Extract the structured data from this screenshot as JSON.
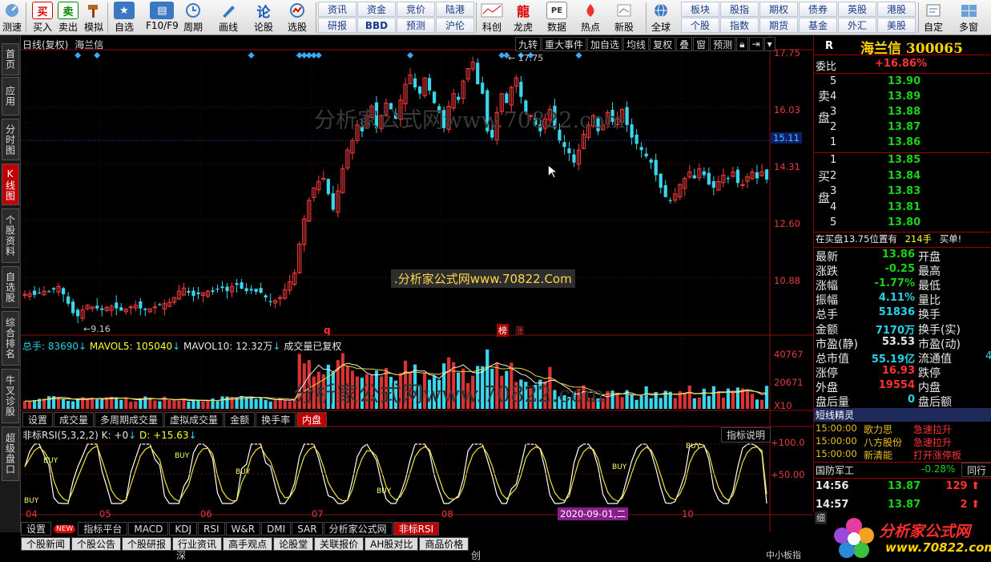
{
  "toolbar": {
    "items": [
      {
        "label": "测速",
        "icon": "speed-icon"
      },
      {
        "label": "买入",
        "icon": "buy-icon",
        "glyph": "买"
      },
      {
        "label": "卖出",
        "icon": "sell-icon",
        "glyph": "卖"
      },
      {
        "label": "模拟",
        "icon": "hammer-icon"
      },
      {
        "label": "自选",
        "icon": "star-icon"
      },
      {
        "label": "F10/F9",
        "icon": "f10-icon"
      },
      {
        "label": "周期",
        "icon": "clock-icon"
      },
      {
        "label": "画线",
        "icon": "pen-icon"
      },
      {
        "label": "论股",
        "icon": "chat-icon",
        "glyph": "论"
      },
      {
        "label": "选股",
        "icon": "select-icon"
      }
    ],
    "grid": [
      [
        "资讯",
        "资金",
        "竞价",
        "陆港"
      ],
      [
        "研报",
        "BBD",
        "预测",
        "沪伦"
      ]
    ],
    "items2": [
      {
        "label": "科创",
        "icon": "chart-icon"
      },
      {
        "label": "龙虎",
        "icon": "dragon-icon"
      },
      {
        "label": "数据",
        "icon": "pe-icon"
      },
      {
        "label": "热点",
        "icon": "hot-icon"
      },
      {
        "label": "新股",
        "icon": "newstock-icon"
      },
      {
        "label": "全球",
        "icon": "globe-icon"
      }
    ],
    "grid2": [
      [
        "板块",
        "股指",
        "期权",
        "债券",
        "英股",
        "港股"
      ],
      [
        "个股",
        "指数",
        "期货",
        "基金",
        "外汇",
        "美股"
      ]
    ],
    "items3": [
      {
        "label": "自定",
        "icon": "custom-icon"
      },
      {
        "label": "多窗",
        "icon": "multiwin-icon"
      }
    ]
  },
  "left_tabs": [
    "首页",
    "应用",
    "分时图",
    "K线图",
    "个股资料",
    "自选股",
    "综合排名",
    "牛叉诊股",
    "超级盘口"
  ],
  "chart": {
    "title": "日线(复权)",
    "stock": "海兰信",
    "top_buttons": [
      "九转",
      "重大事件",
      "加自选",
      "均线",
      "复权",
      "叠",
      "窗",
      "预测"
    ],
    "price_axis": [
      "17.75",
      "16.03",
      "15.11",
      "14.31",
      "12.60",
      "10.88"
    ],
    "high_label": "17.75",
    "low_label": "9.16",
    "marker_q": "q",
    "marker_list": "榜",
    "marker_zhang": "涨",
    "watermark": "分析家公式网www.70822.com",
    "watermark_center": ".分析家公式网www.70822.Com",
    "volume_header": {
      "a": "总手: 83690",
      "b": "MAVOL5: 105040",
      "c": "MAVOL10: 12.32万",
      "d": "成交量已复权"
    },
    "volume_axis": [
      "40767",
      "20671",
      "X10"
    ],
    "vol_tabs": [
      "设置",
      "成交量",
      "多周期成交量",
      "虚拟成交量",
      "金额",
      "换手率",
      "内盘"
    ],
    "rsi_header": {
      "a": "非标RSI(5,3,2,2)",
      "b": "K: +0",
      "c": "D: +15.63"
    },
    "rsi_help": "指标说明",
    "rsi_axis": [
      "+100.0",
      "+50.00"
    ],
    "buy_label": "BUY",
    "months": [
      "04",
      "05",
      "06",
      "07",
      "08",
      "10"
    ],
    "cursor_date": "2020-09-01,二",
    "bottom_tabs": [
      "设置",
      "NEW",
      "指标平台",
      "MACD",
      "KDJ",
      "RSI",
      "W&R",
      "DMI",
      "SAR",
      "分析家公式网",
      "非标RSI"
    ],
    "news_tabs": [
      "个股新闻",
      "个股公告",
      "个股研报",
      "行业资讯",
      "高手观点",
      "论股堂",
      "关联报价",
      "AH股对比",
      "商品价格"
    ],
    "sh": "深",
    "cy": "创",
    "small": "中小板指"
  },
  "quote": {
    "r": "R",
    "name": "海兰信",
    "code": "300065",
    "wei_label": "委比",
    "wei_value": "+16.86%",
    "sell_label": "卖盘",
    "buy_label": "买盘",
    "asks": [
      {
        "lv": "5",
        "p": "13.90"
      },
      {
        "lv": "4",
        "p": "13.89"
      },
      {
        "lv": "3",
        "p": "13.88"
      },
      {
        "lv": "2",
        "p": "13.87"
      },
      {
        "lv": "1",
        "p": "13.86"
      }
    ],
    "bids": [
      {
        "lv": "1",
        "p": "13.85"
      },
      {
        "lv": "2",
        "p": "13.84"
      },
      {
        "lv": "3",
        "p": "13.83"
      },
      {
        "lv": "4",
        "p": "13.81"
      },
      {
        "lv": "5",
        "p": "13.80"
      }
    ],
    "notice": {
      "a": "在买盘13.75位置有",
      "b": "214手",
      "c": "买单!"
    },
    "stats": [
      {
        "k": "最新",
        "v": "13.86",
        "c": "grn",
        "k2": "开盘"
      },
      {
        "k": "涨跌",
        "v": "-0.25",
        "c": "grn",
        "k2": "最高"
      },
      {
        "k": "涨幅",
        "v": "-1.77%",
        "c": "grn",
        "k2": "最低"
      },
      {
        "k": "振幅",
        "v": "4.11%",
        "c": "cyan",
        "k2": "量比"
      },
      {
        "k": "总手",
        "v": "51836",
        "c": "cyan",
        "k2": "换手"
      },
      {
        "k": "金额",
        "v": "7170万",
        "c": "cyan",
        "k2": "换手(实)"
      },
      {
        "k": "市盈(静)",
        "v": "53.53",
        "c": "wht",
        "k2": "市盈(动)"
      },
      {
        "k": "总市值",
        "v": "55.19亿",
        "c": "cyan",
        "k2": "流通值",
        "v2": "4"
      },
      {
        "k": "涨停",
        "v": "16.93",
        "c": "red",
        "k2": "跌停"
      },
      {
        "k": "外盘",
        "v": "19554",
        "c": "red",
        "k2": "内盘"
      },
      {
        "k": "盘后量",
        "v": "0",
        "c": "cyan",
        "k2": "盘后额"
      }
    ],
    "sprite_title": "短线精灵",
    "sprite": [
      {
        "t": "15:00:00",
        "n": "歌力思",
        "e": "急速拉升"
      },
      {
        "t": "15:00:00",
        "n": "八方股份",
        "e": "急速拉升"
      },
      {
        "t": "15:00:00",
        "n": "新清能",
        "e": "打开涨停板"
      }
    ],
    "sector": {
      "name": "国防军工",
      "chg": "-0.28%",
      "btn": "同行"
    },
    "ticks": [
      {
        "t": "14:56",
        "p": "13.87",
        "v": "129"
      },
      {
        "t": "14:57",
        "p": "13.87",
        "v": "2"
      }
    ],
    "detail_tab": "细",
    "logo": "分析家公式网",
    "logo_url": "www.70822.com"
  },
  "chart_data": {
    "type": "candlestick",
    "title": "日线(复权) 海兰信",
    "x_months": [
      "04",
      "05",
      "06",
      "07",
      "08",
      "10"
    ],
    "ylim": [
      9.0,
      17.9
    ],
    "high": 17.75,
    "low": 9.16,
    "close_series": [
      10.2,
      10.22,
      10.18,
      10.25,
      10.3,
      10.28,
      10.35,
      10.45,
      10.2,
      9.9,
      9.6,
      9.5,
      9.7,
      9.85,
      9.8,
      9.75,
      9.7,
      9.78,
      9.82,
      9.75,
      9.68,
      9.72,
      9.8,
      9.85,
      9.75,
      9.7,
      9.74,
      9.8,
      9.85,
      9.9,
      9.95,
      10.1,
      10.3,
      10.4,
      10.25,
      10.15,
      10.2,
      10.25,
      10.3,
      10.28,
      10.35,
      10.4,
      10.3,
      10.45,
      10.5,
      10.38,
      10.3,
      10.32,
      10.28,
      10.25,
      10.1,
      9.95,
      10.0,
      10.1,
      10.35,
      10.6,
      10.88,
      11.8,
      12.6,
      13.2,
      13.6,
      13.8,
      13.9,
      13.4,
      12.9,
      13.5,
      14.2,
      14.8,
      15.1,
      15.6,
      15.4,
      15.9,
      16.2,
      15.5,
      15.9,
      16.3,
      16.1,
      15.8,
      16.4,
      16.9,
      17.2,
      16.8,
      16.6,
      17.1,
      16.7,
      16.3,
      16.0,
      15.5,
      16.2,
      16.6,
      16.4,
      17.0,
      17.4,
      17.6,
      16.9,
      16.6,
      15.4,
      15.2,
      16.0,
      16.6,
      16.3,
      16.8,
      17.1,
      16.5,
      16.0,
      15.9,
      15.6,
      15.4,
      15.8,
      16.1,
      15.5,
      15.1,
      14.9,
      14.7,
      14.4,
      14.8,
      15.3,
      15.6,
      15.9,
      15.4,
      15.6,
      16.0,
      15.7,
      15.8,
      16.1,
      15.6,
      15.2,
      15.0,
      14.8,
      14.6,
      14.4,
      14.0,
      13.6,
      13.3,
      13.2,
      13.4,
      13.7,
      13.9,
      14.1,
      13.9,
      14.2,
      14.0,
      13.7,
      13.6,
      13.8,
      14.0,
      13.9,
      14.1,
      13.75,
      13.7,
      13.95,
      14.1,
      13.9,
      14.11,
      13.86
    ],
    "volume_axis_max": 40767,
    "rsi": {
      "name": "非标RSI(5,3,2,2)",
      "K": 0,
      "D": 15.63,
      "ylim": [
        0,
        100
      ]
    }
  }
}
